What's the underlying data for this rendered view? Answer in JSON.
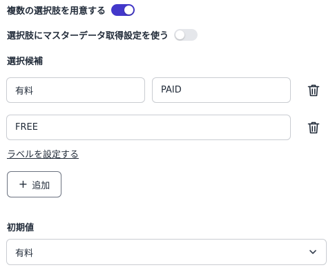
{
  "options": {
    "multiple_label": "複数の選択肢を用意する",
    "multiple_enabled": true,
    "master_label": "選択肢にマスターデータ取得設定を使う",
    "master_enabled": false
  },
  "choices": {
    "heading": "選択候補",
    "items": [
      {
        "label": "有料",
        "value": "PAID"
      },
      {
        "label": "",
        "value": "FREE"
      }
    ],
    "set_label_link": "ラベルを設定する",
    "add_button": "追加"
  },
  "initial": {
    "heading": "初期値",
    "selected": "有料"
  },
  "icons": {
    "delete": "trash-icon",
    "add": "plus-icon",
    "dropdown": "chevron-down-icon"
  },
  "colors": {
    "toggle_on": "#4338ca",
    "toggle_off": "#e5e7eb"
  }
}
